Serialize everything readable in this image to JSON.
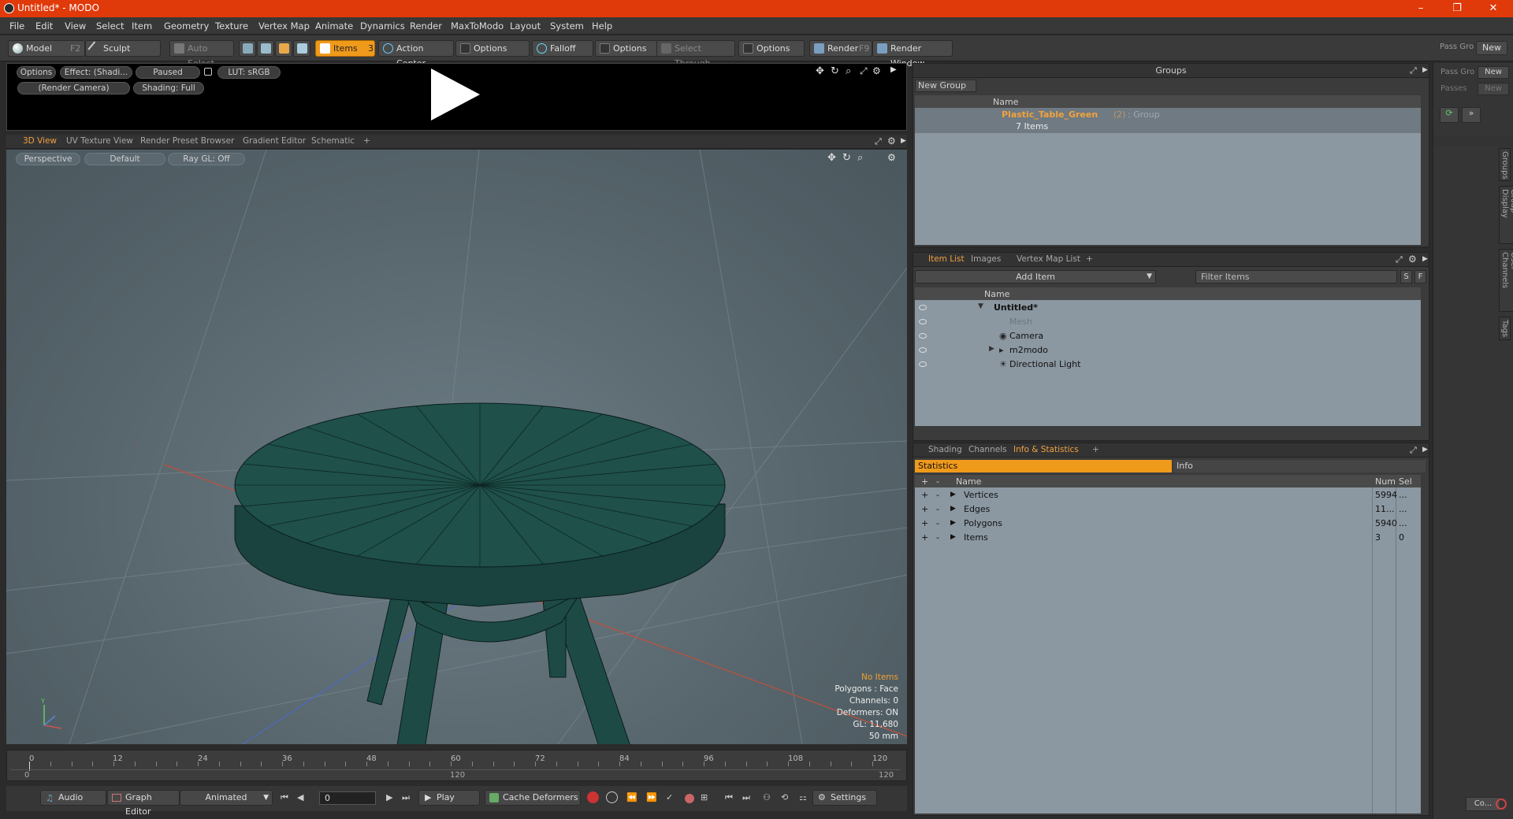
{
  "window": {
    "title": "Untitled* - MODO",
    "minimize": "–",
    "restore": "❐",
    "close": "✕"
  },
  "menu": [
    "File",
    "Edit",
    "View",
    "Select",
    "Item",
    "Geometry",
    "Texture",
    "Vertex Map",
    "Animate",
    "Dynamics",
    "Render",
    "MaxToModo",
    "Layout",
    "System",
    "Help"
  ],
  "toolbar": {
    "model": "Model",
    "model_key": "F2",
    "sculpt": "Sculpt",
    "auto_select": "Auto Select",
    "items": "Items",
    "items_key": "3",
    "action_center": "Action Center",
    "options1": "Options",
    "falloff": "Falloff",
    "options2": "Options",
    "select_through": "Select Through",
    "options3": "Options",
    "render": "Render",
    "render_key": "F9",
    "render_window": "Render Window",
    "pass_gro": "Pass Gro",
    "passes": "Passes",
    "new1": "New",
    "new2": "New"
  },
  "preview": {
    "options": "Options",
    "effect": "Effect: (Shadi...",
    "paused": "Paused",
    "lut": "LUT: sRGB",
    "camera": "(Render Camera)",
    "shading": "Shading: Full"
  },
  "viewport_tabs": [
    "3D View",
    "UV Texture View",
    "Render Preset Browser",
    "Gradient Editor",
    "Schematic",
    "+"
  ],
  "viewport": {
    "perspective": "Perspective",
    "default": "Default",
    "raygl": "Ray GL: Off",
    "info": {
      "no_items": "No Items",
      "polygons": "Polygons : Face",
      "channels": "Channels: 0",
      "deformers": "Deformers: ON",
      "gl": "GL: 11,680",
      "mm": "50 mm"
    }
  },
  "timeline": {
    "ticks": [
      "0",
      "12",
      "24",
      "36",
      "48",
      "60",
      "72",
      "84",
      "96",
      "108",
      "120"
    ],
    "start": "0",
    "mid": "120",
    "end": "120"
  },
  "bottombar": {
    "audio": "Audio",
    "graph_editor": "Graph Editor",
    "animated": "Animated",
    "frame": "0",
    "play": "Play",
    "cache": "Cache Deformers",
    "settings": "Settings",
    "co": "Co..."
  },
  "groups": {
    "title": "Groups",
    "new_group": "New Group",
    "name_col": "Name",
    "group_name": "Plastic_Table_Green",
    "group_count": "(2)",
    "group_type": ": Group",
    "items": "7 Items"
  },
  "itemlist": {
    "tabs": [
      "Item List",
      "Images",
      "Vertex Map List",
      "+"
    ],
    "add_item": "Add Item",
    "filter": "Filter Items",
    "s": "S",
    "f": "F",
    "name_col": "Name",
    "rows": [
      {
        "name": "Untitled*",
        "depth": 0
      },
      {
        "name": "Mesh",
        "depth": 1
      },
      {
        "name": "Camera",
        "depth": 1
      },
      {
        "name": "m2modo",
        "depth": 1
      },
      {
        "name": "Directional Light",
        "depth": 1
      }
    ]
  },
  "stats": {
    "tabs": [
      "Shading",
      "Channels",
      "Info & Statistics",
      "+"
    ],
    "statistics": "Statistics",
    "info": "Info",
    "name_col": "Name",
    "num_col": "Num",
    "sel_col": "Sel",
    "rows": [
      {
        "name": "Vertices",
        "num": "5994",
        "sel": "..."
      },
      {
        "name": "Edges",
        "num": "11...",
        "sel": "..."
      },
      {
        "name": "Polygons",
        "num": "5940",
        "sel": "..."
      },
      {
        "name": "Items",
        "num": "3",
        "sel": "0"
      }
    ]
  },
  "sidetabs": [
    "Groups",
    "Group Display",
    "User Channels",
    "Tags"
  ],
  "colors": {
    "accent": "#f09a1c",
    "title": "#e0390a",
    "table": "#1d4a45"
  }
}
